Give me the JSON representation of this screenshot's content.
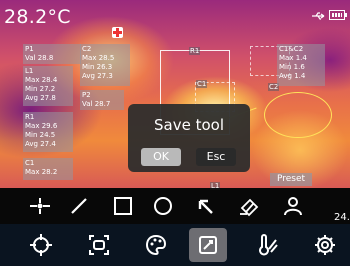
{
  "status": {
    "temperature": "28.2°C",
    "icons": [
      "usb-icon",
      "battery-icon",
      "center-cross-icon"
    ]
  },
  "panels": {
    "p1": {
      "title": "P1",
      "val": "Val 28.8"
    },
    "l1": {
      "title": "L1",
      "max": "Max 28.4",
      "min": "Min 27.2",
      "avg": "Avg 27.8"
    },
    "r1": {
      "title": "R1",
      "max": "Max 29.6",
      "min": "Min 24.5",
      "avg": "Avg 27.4"
    },
    "c1": {
      "title": "C1",
      "max": "Max 28.2"
    },
    "c2": {
      "title": "C2",
      "max": "Max 28.5",
      "min": "Min 26.3",
      "avg": "Avg 27.3"
    },
    "p2": {
      "title": "P2",
      "val": "Val 28.7"
    },
    "c1c2": {
      "title": "C1&C2",
      "max": "Max 1.4",
      "min": "Min 1.6",
      "avg": "Avg 1.4"
    }
  },
  "overlay_labels": {
    "r1": "R1",
    "c1": "C1",
    "c2": "C2",
    "l1": "L1"
  },
  "dialog": {
    "title": "Save tool",
    "ok": "OK",
    "esc": "Esc"
  },
  "preset": "Preset",
  "side_number": "24.",
  "tools": [
    "point-tool-icon",
    "line-tool-icon",
    "rectangle-tool-icon",
    "circle-tool-icon",
    "arrow-tool-icon",
    "eraser-tool-icon",
    "user-tool-icon"
  ],
  "menu": {
    "items": [
      "crosshair-icon",
      "image-mode-icon",
      "palette-icon",
      "measure-tool-icon",
      "thermometer-icon",
      "settings-icon"
    ],
    "selected": "measure-tool-icon"
  }
}
